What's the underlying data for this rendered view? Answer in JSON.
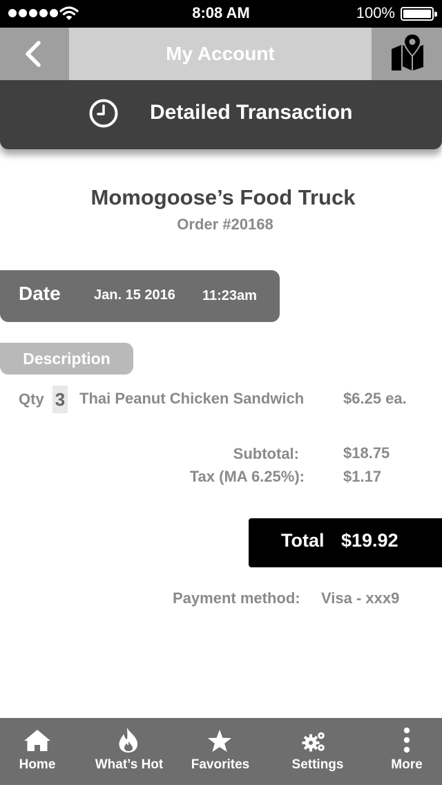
{
  "status_bar": {
    "time": "8:08 AM",
    "battery": "100%",
    "icons": [
      "signal-dots-icon",
      "wifi-icon",
      "battery-icon"
    ]
  },
  "nav": {
    "back_icon": "chevron-left-icon",
    "title": "My Account",
    "map_icon": "map-pin-icon"
  },
  "section": {
    "icon": "clock-icon",
    "title": "Detailed Transaction"
  },
  "vendor": {
    "name": "Momogoose’s Food Truck",
    "order": "Order #20168"
  },
  "date": {
    "label": "Date",
    "date": "Jan. 15 2016",
    "time": "11:23am"
  },
  "description": {
    "tab_label": "Description",
    "items": [
      {
        "qty_label": "Qty",
        "qty": "3",
        "name": "Thai Peanut Chicken Sandwich",
        "price": "$6.25 ea."
      }
    ]
  },
  "totals": {
    "subtotal_label": "Subtotal:",
    "subtotal": "$18.75",
    "tax_label": "Tax (MA 6.25%):",
    "tax": "$1.17",
    "total_label": "Total",
    "total": "$19.92"
  },
  "payment": {
    "label": "Payment method:",
    "value": "Visa - xxx9"
  },
  "tab_bar": {
    "items": [
      {
        "label": "Home",
        "icon": "home-icon"
      },
      {
        "label": "What’s Hot",
        "icon": "flame-icon"
      },
      {
        "label": "Favorites",
        "icon": "star-icon"
      },
      {
        "label": "Settings",
        "icon": "gears-icon"
      },
      {
        "label": "More",
        "icon": "more-vertical-icon"
      }
    ]
  },
  "colors": {
    "status_bar": "#000000",
    "nav_bar": "#cfcfcf",
    "nav_buttons": "#9f9f9f",
    "section_header": "#404040",
    "date_pill": "#6e6e6e",
    "description_tab": "#b9b9b9",
    "total_box": "#000000",
    "tab_bar": "#6e6e6e"
  }
}
